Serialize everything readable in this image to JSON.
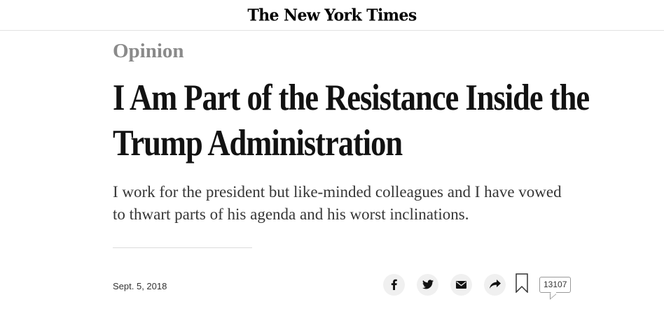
{
  "masthead": {
    "logo_text": "The New York Times"
  },
  "article": {
    "section": "Opinion",
    "headline": "I Am Part of the Resistance Inside the Trump Administration",
    "summary": "I work for the president but like-minded colleagues and I have vowed to thwart parts of his agenda and his worst inclinations.",
    "date": "Sept. 5, 2018"
  },
  "share": {
    "buttons": [
      {
        "icon": "facebook-icon"
      },
      {
        "icon": "twitter-icon"
      },
      {
        "icon": "email-icon"
      },
      {
        "icon": "share-arrow-icon"
      }
    ],
    "bookmark_icon": "bookmark-icon",
    "comment_count": "13107"
  }
}
